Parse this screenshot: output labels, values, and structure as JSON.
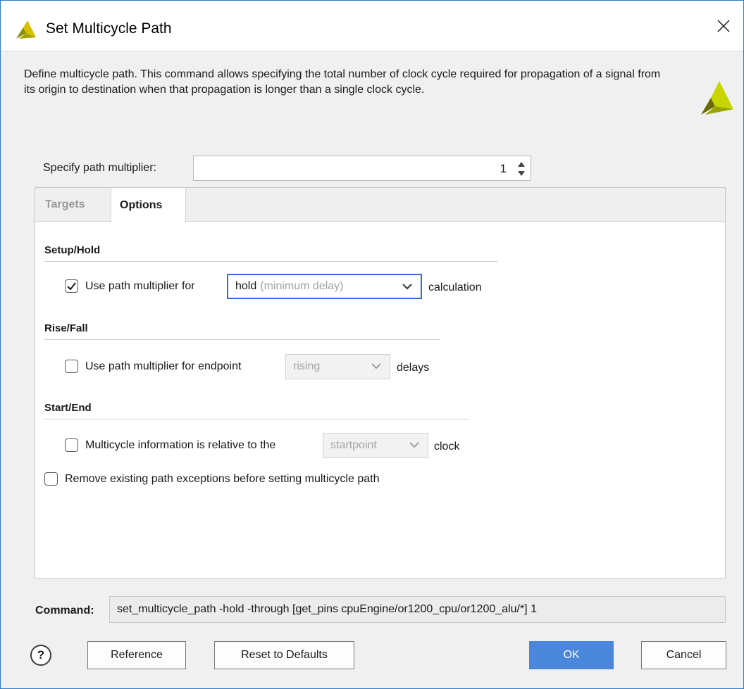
{
  "window": {
    "title": "Set Multicycle Path",
    "description": "Define multicycle path. This command allows specifying the total number of clock cycle required for propagation of a signal from its origin to destination when that propagation is longer than a single clock cycle."
  },
  "multiplier": {
    "label": "Specify path multiplier:",
    "value": "1"
  },
  "tabs": [
    {
      "label": "Targets",
      "active": false
    },
    {
      "label": "Options",
      "active": true
    }
  ],
  "options": {
    "setup_hold": {
      "title": "Setup/Hold",
      "checked": true,
      "label": "Use path multiplier for",
      "select_value": "hold",
      "select_hint": "(minimum delay)",
      "suffix": "calculation"
    },
    "rise_fall": {
      "title": "Rise/Fall",
      "checked": false,
      "label": "Use path multiplier for endpoint",
      "select_value": "rising",
      "suffix": "delays"
    },
    "start_end": {
      "title": "Start/End",
      "checked": false,
      "label": "Multicycle information is relative to the",
      "select_value": "startpoint",
      "suffix": "clock"
    },
    "remove_exceptions": {
      "checked": false,
      "label": "Remove existing path exceptions before setting multicycle path"
    }
  },
  "command": {
    "label": "Command:",
    "value": "set_multicycle_path -hold -through [get_pins cpuEngine/or1200_cpu/or1200_alu/*] 1"
  },
  "buttons": {
    "help": "?",
    "reference": "Reference",
    "reset": "Reset to Defaults",
    "ok": "OK",
    "cancel": "Cancel"
  },
  "colors": {
    "accent": "#4a86d9",
    "focus_border": "#2e6fd0",
    "logo_dark": "#6a6a00",
    "logo_light": "#c9d500"
  }
}
